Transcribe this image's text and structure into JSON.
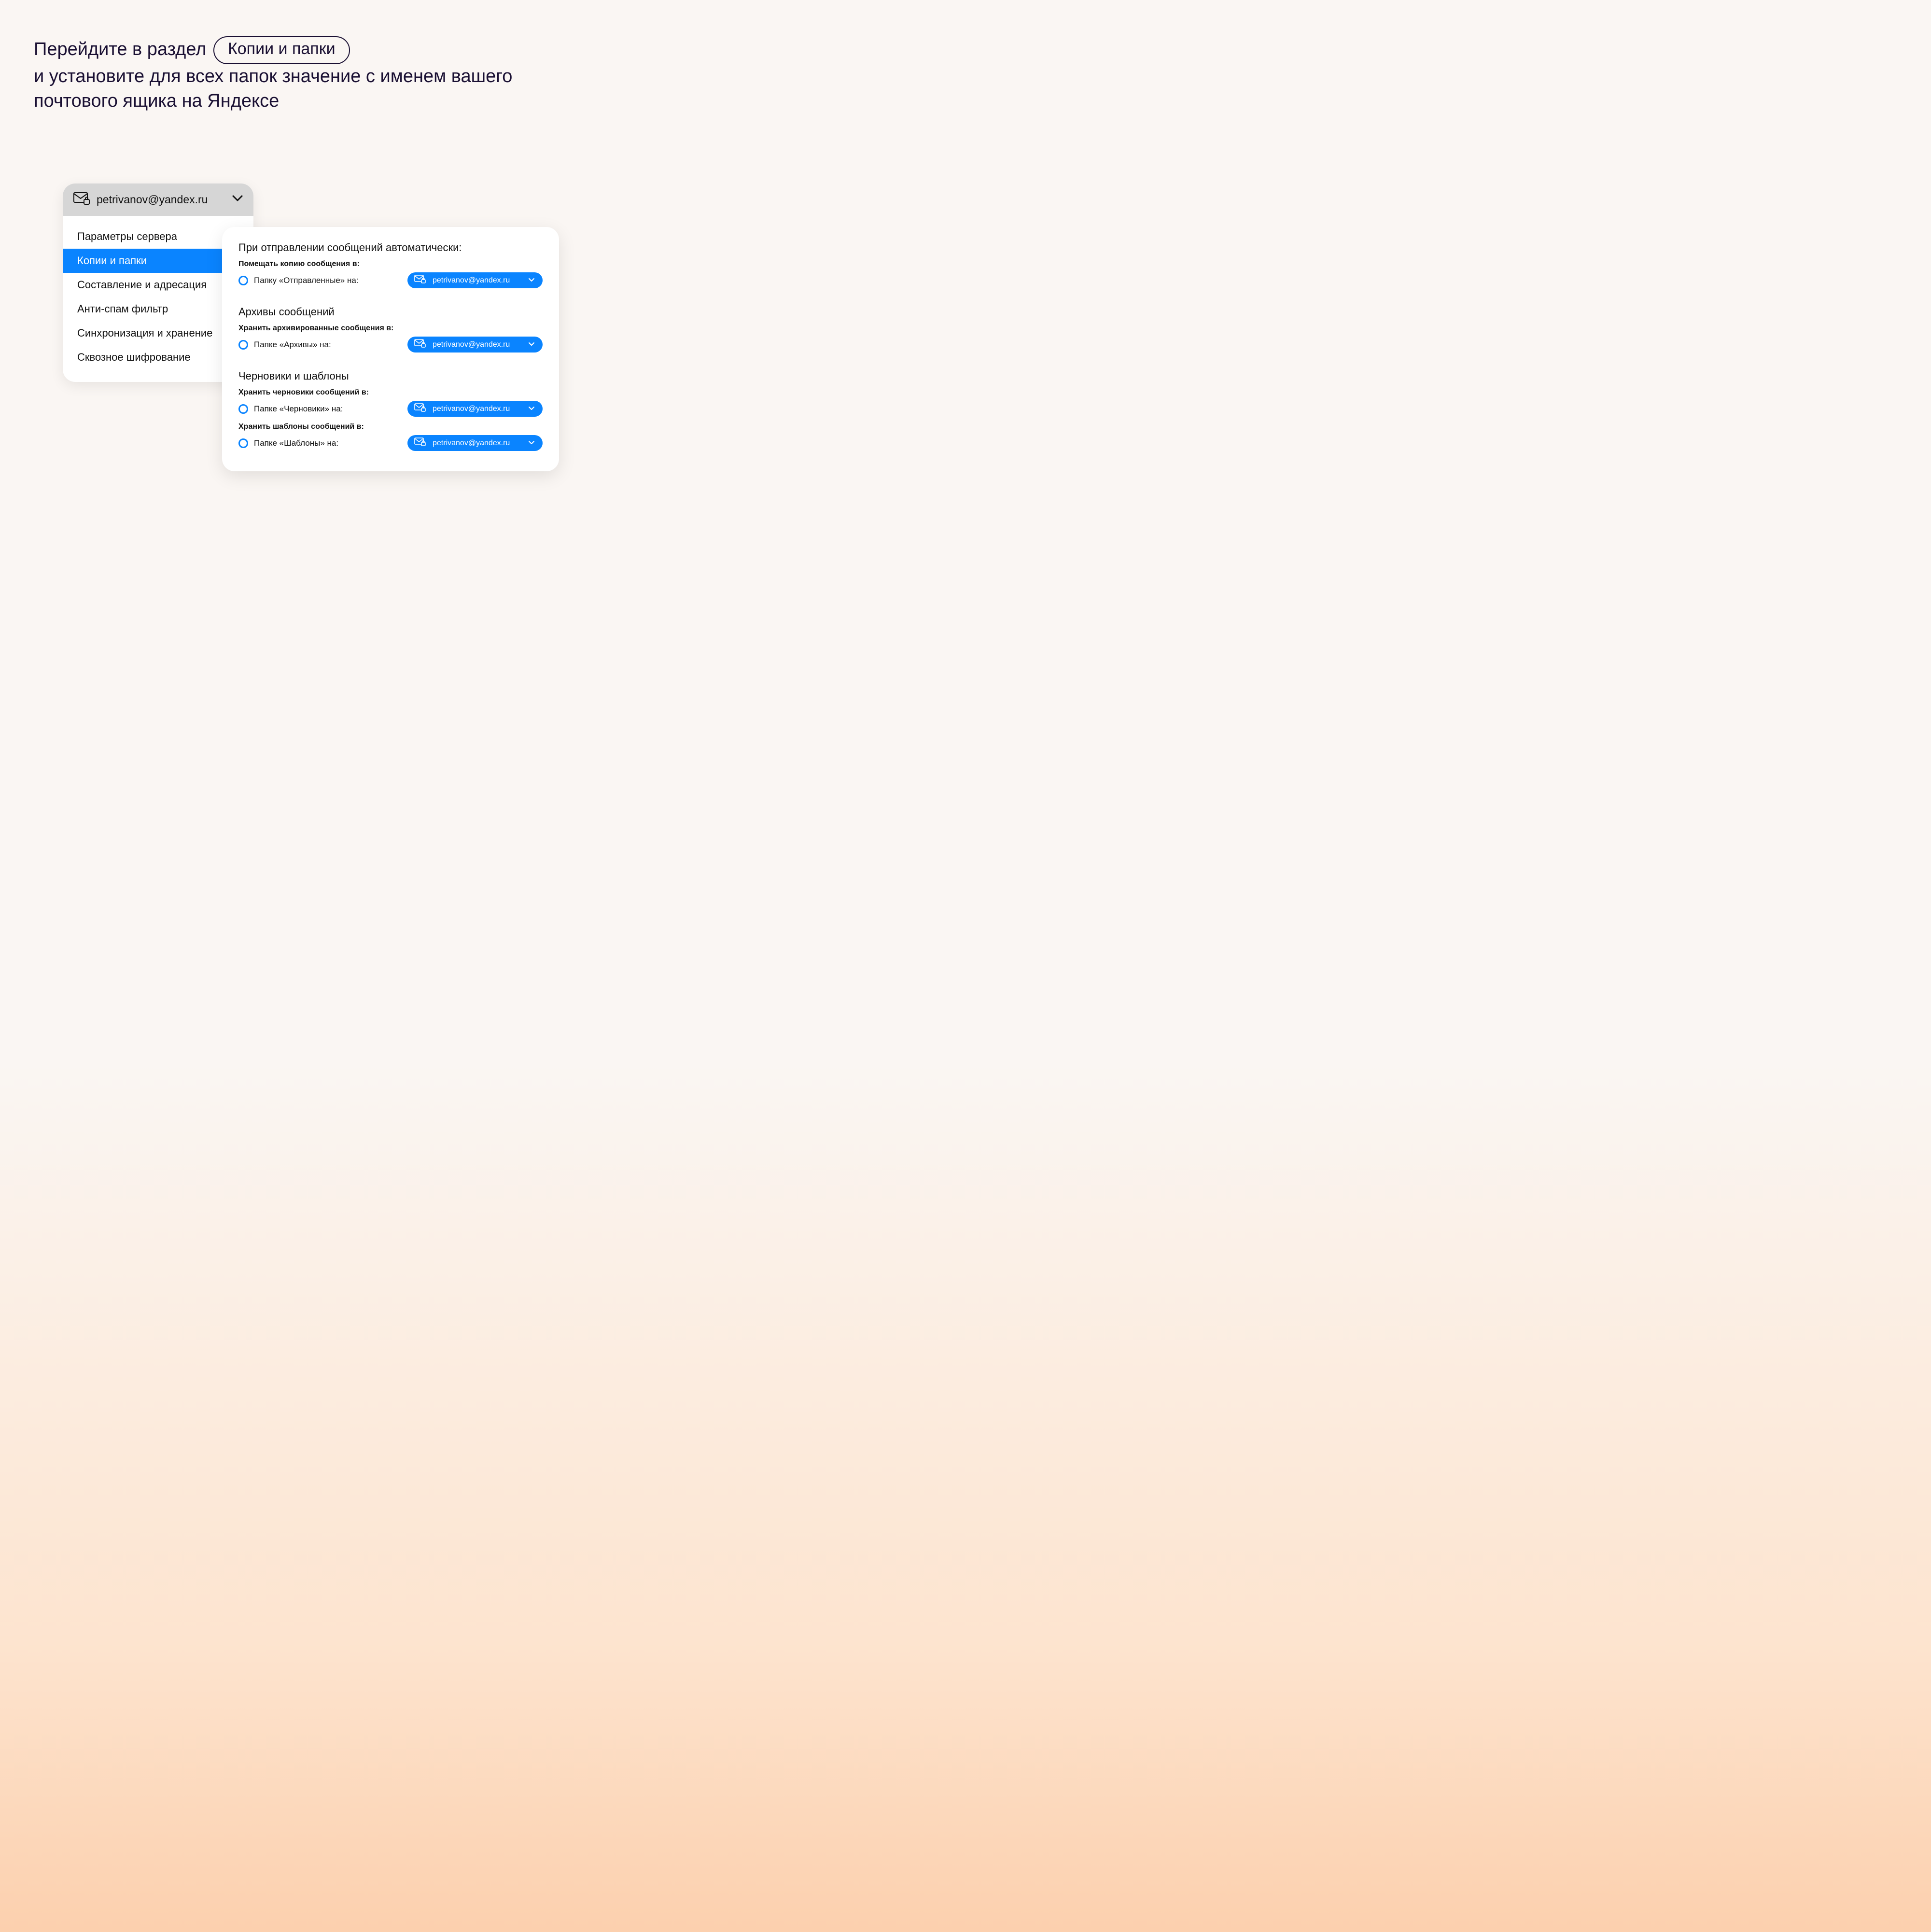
{
  "instructions": {
    "part1": "Перейдите в раздел",
    "pill": "Копии и папки",
    "part2": "и установите для всех папок значение с именем вашего почтового ящика на Яндексе"
  },
  "account": {
    "email": "petrivanov@yandex.ru"
  },
  "sidebar": {
    "items": [
      "Параметры сервера",
      "Копии и папки",
      "Составление и адресация",
      "Анти-спам фильтр",
      "Синхронизация и хранение",
      "Сквозное шифрование"
    ],
    "active_index": 1
  },
  "settings": {
    "sections": [
      {
        "title": "При отправлении сообщений автоматически:",
        "rows": [
          {
            "sub": "Помещать копию сообщения в:",
            "option": "Папку «Отправленные» на:",
            "value": "petrivanov@yandex.ru"
          }
        ]
      },
      {
        "title": "Архивы сообщений",
        "rows": [
          {
            "sub": "Хранить архивированные сообщения в:",
            "option": "Папке «Архивы» на:",
            "value": "petrivanov@yandex.ru"
          }
        ]
      },
      {
        "title": "Черновики и шаблоны",
        "rows": [
          {
            "sub": "Хранить черновики сообщений в:",
            "option": "Папке «Черновики» на:",
            "value": "petrivanov@yandex.ru"
          },
          {
            "sub": "Хранить шаблоны сообщений в:",
            "option": "Папке «Шаблоны» на:",
            "value": "petrivanov@yandex.ru"
          }
        ]
      }
    ]
  }
}
